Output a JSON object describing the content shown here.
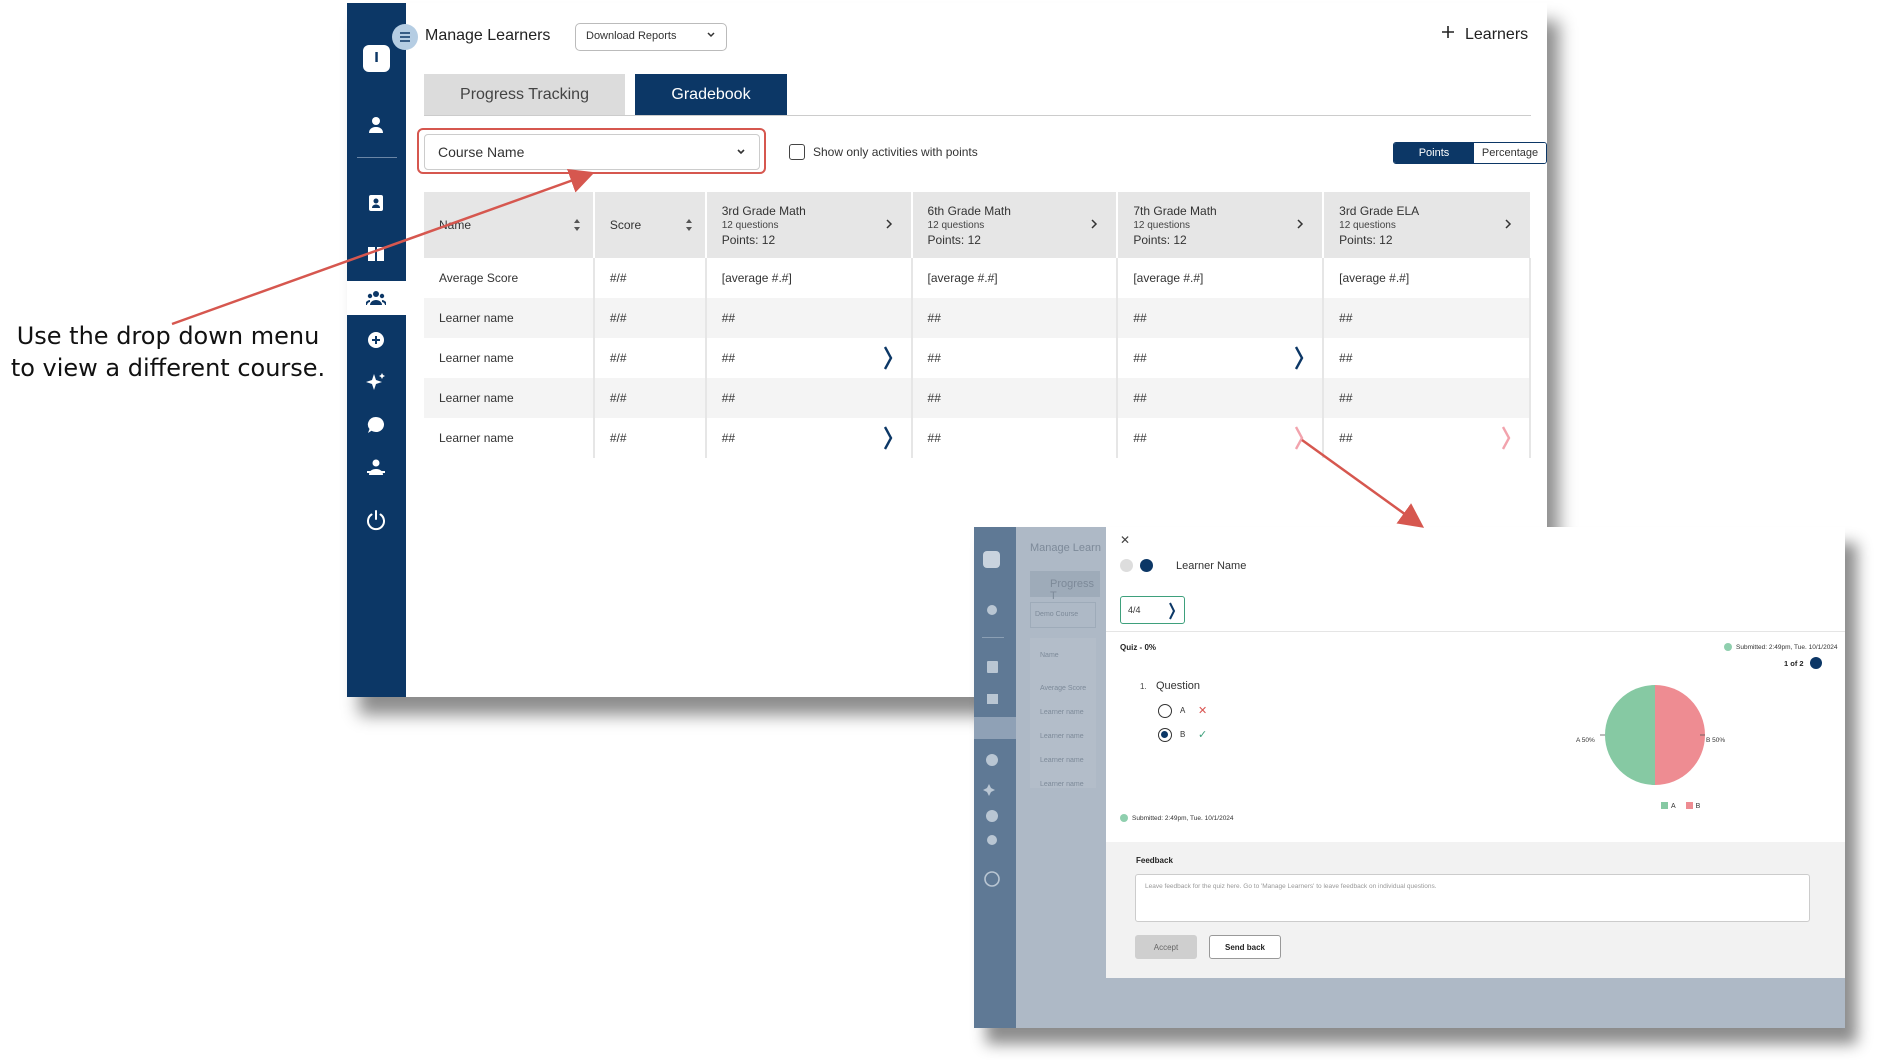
{
  "callout": {
    "line1": "Use the drop down menu",
    "line2": "to view a different course."
  },
  "sidebar": {
    "logo_letter": "I",
    "icons": [
      "person-icon",
      "contacts-icon",
      "book-icon",
      "group-icon",
      "add-circle-icon",
      "sparkle-icon",
      "chat-icon",
      "teacher-icon",
      "power-icon"
    ],
    "active_item": "group-icon"
  },
  "header": {
    "title": "Manage Learners",
    "download_reports": "Download Reports",
    "add_learners": "Learners"
  },
  "tabs": [
    {
      "label": "Progress Tracking"
    },
    {
      "label": "Gradebook"
    }
  ],
  "filters": {
    "course_select": "Course Name",
    "show_only_points": "Show only activities with points",
    "toggle": {
      "points": "Points",
      "percentage": "Percentage",
      "selected": "Points"
    }
  },
  "table": {
    "col_name": "Name",
    "col_score": "Score",
    "activities": [
      {
        "title": "3rd Grade Math",
        "questions": "12 questions",
        "points": "Points: 12"
      },
      {
        "title": "6th Grade Math",
        "questions": "12 questions",
        "points": "Points: 12"
      },
      {
        "title": "7th Grade Math",
        "questions": "12 questions",
        "points": "Points: 12"
      },
      {
        "title": "3rd Grade ELA",
        "questions": "12 questions",
        "points": "Points: 12"
      }
    ],
    "rows": [
      {
        "name": "Average Score",
        "score": "#/#",
        "cells": [
          "[average #.#]",
          "[average #.#]",
          "[average #.#]",
          "[average #.#]"
        ]
      },
      {
        "name": "Learner name",
        "score": "#/#",
        "cells": [
          "##",
          "##",
          "##",
          "##"
        ]
      },
      {
        "name": "Learner name",
        "score": "#/#",
        "cells": [
          "##",
          "##",
          "##",
          "##"
        ]
      },
      {
        "name": "Learner name",
        "score": "#/#",
        "cells": [
          "##",
          "##",
          "##",
          "##"
        ]
      },
      {
        "name": "Learner name",
        "score": "#/#",
        "cells": [
          "##",
          "##",
          "##",
          "##"
        ]
      }
    ]
  },
  "inset": {
    "bg": {
      "title": "Manage Learn",
      "tab": "Progress T",
      "course": "Demo Course",
      "col_name": "Name",
      "rows": [
        "Average Score",
        "Learner name",
        "Learner name",
        "Learner name",
        "Learner name"
      ]
    },
    "learner_name": "Learner Name",
    "score": "4/4",
    "quiz_title": "Quiz - 0%",
    "submitted_top": "Submitted: 2:49pm, Tue. 10/1/2024",
    "pager": "1 of 2",
    "question": {
      "number": "1.",
      "text": "Question"
    },
    "options": [
      {
        "label": "A",
        "selected": false,
        "result": "incorrect"
      },
      {
        "label": "B",
        "selected": true,
        "result": "correct"
      }
    ],
    "submitted_bottom": "Submitted: 2:49pm, Tue. 10/1/2024",
    "feedback": {
      "title": "Feedback",
      "placeholder": "Leave feedback for the quiz here. Go to 'Manage Learners' to leave feedback on individual questions.",
      "accept": "Accept",
      "send_back": "Send back"
    }
  },
  "chart_data": {
    "type": "pie",
    "categories": [
      "A",
      "B"
    ],
    "values": [
      50,
      50
    ],
    "labels": [
      "A  50%",
      "B  50%"
    ],
    "legend": [
      "A",
      "B"
    ],
    "legend_position": "bottom",
    "colors": [
      "#86c9a3",
      "#ee8c92"
    ]
  },
  "colors": {
    "navy": "#0c3766",
    "annotation_red": "#d6574f",
    "green": "#3ea07c"
  }
}
